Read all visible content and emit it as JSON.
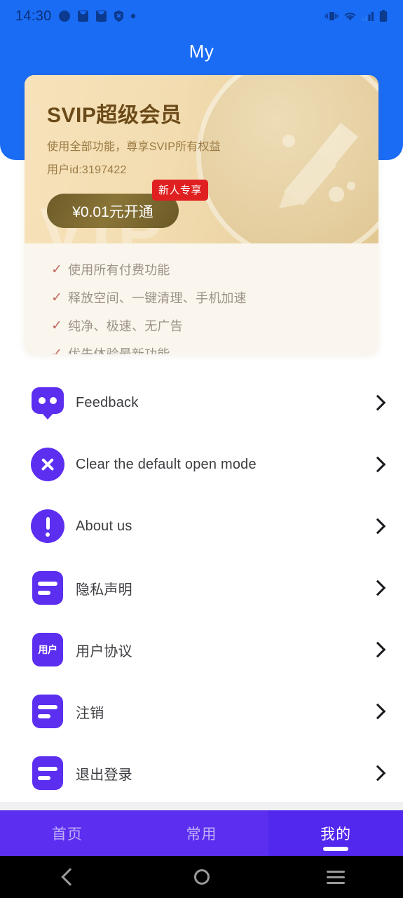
{
  "statusbar": {
    "time": "14:30",
    "left_icons": [
      "compass-icon",
      "download-icon",
      "download-icon",
      "shield-x-icon",
      "dot-icon"
    ],
    "right_icons": [
      "vibrate-icon",
      "wifi-icon",
      "signal-icon",
      "battery-icon"
    ]
  },
  "header": {
    "title": "My",
    "background_color": "#1a6cf5"
  },
  "vip_card": {
    "title": "SVIP超级会员",
    "subtitle": "使用全部功能，尊享SVIP所有权益",
    "user_id": "用户id:3197422",
    "buy_button": "¥0.01元开通",
    "badge": "新人专享",
    "watermark": "VIP",
    "badge_color": "#e02020",
    "card_color": "#f2dcb0",
    "coin_icon": "coin-broom-icon"
  },
  "benefits": {
    "check_color": "#c0695f",
    "items": [
      "使用所有付费功能",
      "释放空间、一键清理、手机加速",
      "纯净、极速、无广告",
      "优先体验最新功能"
    ]
  },
  "menu": {
    "accent_color": "#5b2ef0",
    "items": [
      {
        "label": "Feedback",
        "icon": "chat-bubble-icon"
      },
      {
        "label": "Clear the default open mode",
        "icon": "close-circle-icon"
      },
      {
        "label": "About us",
        "icon": "info-circle-icon"
      },
      {
        "label": "隐私声明",
        "icon": "document-icon"
      },
      {
        "label": "用户协议",
        "icon": "user-agreement-icon",
        "icon_text": "用户"
      },
      {
        "label": "注销",
        "icon": "document-icon"
      },
      {
        "label": "退出登录",
        "icon": "document-icon"
      }
    ]
  },
  "tabbar": {
    "active_index": 2,
    "items": [
      {
        "label": "首页"
      },
      {
        "label": "常用"
      },
      {
        "label": "我的"
      }
    ]
  },
  "sysnav": {
    "back": "back-icon",
    "home": "home-icon",
    "recents": "recents-icon"
  }
}
